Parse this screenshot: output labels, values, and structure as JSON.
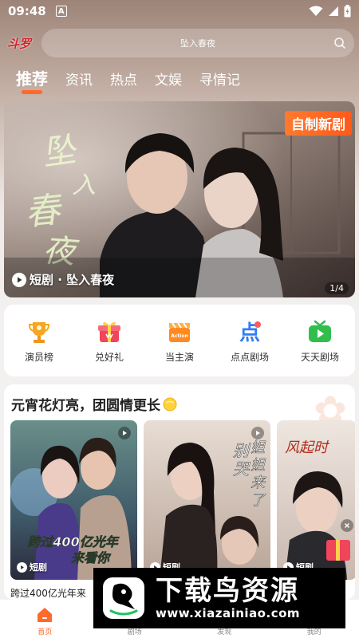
{
  "status_bar": {
    "time": "09:48",
    "notification_icon": "A"
  },
  "app": {
    "logo_text": "斗罗"
  },
  "search": {
    "placeholder": "坠入春夜"
  },
  "tabs": [
    {
      "label": "推荐",
      "active": true
    },
    {
      "label": "资讯"
    },
    {
      "label": "热点"
    },
    {
      "label": "文娱"
    },
    {
      "label": "寻情记"
    }
  ],
  "banner": {
    "badge": "自制新剧",
    "art_title": "坠入春夜",
    "caption": "短剧 · 坠入春夜",
    "pager": "1/4"
  },
  "quick_entries": [
    {
      "label": "演员榜",
      "icon": "trophy-icon",
      "color": "#f5a623"
    },
    {
      "label": "兑好礼",
      "icon": "gift-icon",
      "color": "#f0455a"
    },
    {
      "label": "当主演",
      "icon": "clapperboard-icon",
      "color": "#ff8a1f"
    },
    {
      "label": "点点剧场",
      "icon": "dot-theater-icon",
      "color": "#2f7df6"
    },
    {
      "label": "天天剧场",
      "icon": "tv-icon",
      "color": "#2fbf4a"
    }
  ],
  "section": {
    "title": "元宵花灯亮，团圆情更长",
    "cards": [
      {
        "tag": "短剧",
        "overlay": "跨过400亿光年来看你",
        "caption": "跨过400亿光年来"
      },
      {
        "tag": "短剧",
        "overlay": "别哭，姐姐来了"
      },
      {
        "tag": "短剧",
        "overlay": "风起时"
      }
    ]
  },
  "bottom_nav": [
    {
      "label": "首页",
      "active": true
    },
    {
      "label": "剧场"
    },
    {
      "label": "发现"
    },
    {
      "label": "我的"
    }
  ],
  "watermark": {
    "text": "下载鸟资源",
    "url": "www.xiazainiao.com"
  },
  "colors": {
    "accent": "#ff6a2a",
    "badge": "#ff5a1a"
  }
}
